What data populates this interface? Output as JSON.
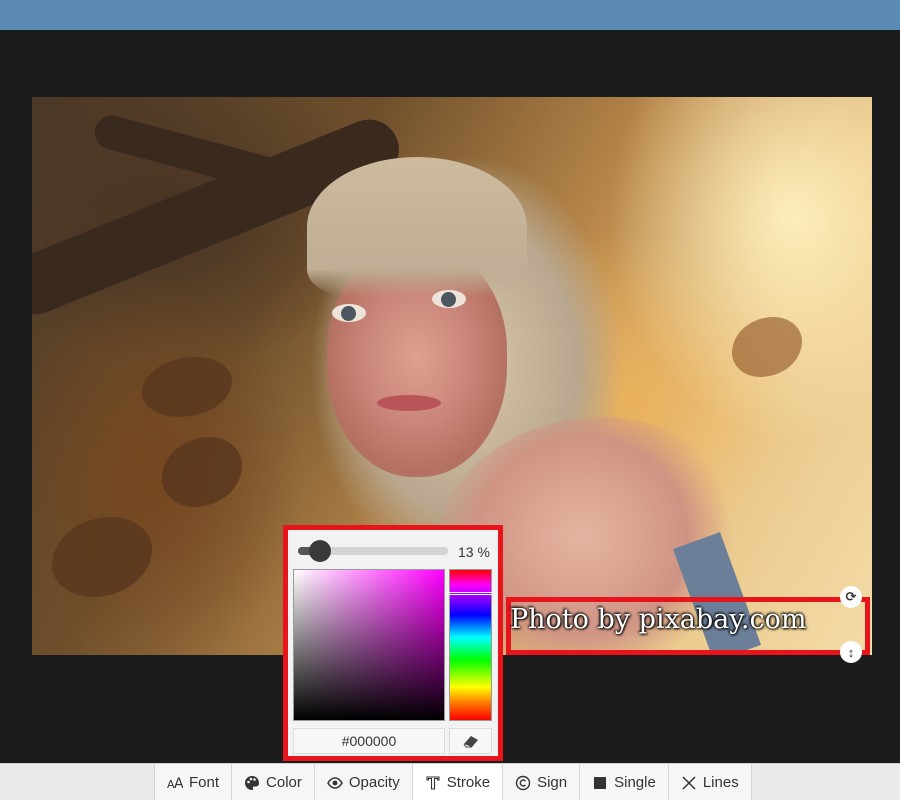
{
  "watermark": {
    "text": "Photo by pixabay.com"
  },
  "picker": {
    "opacity_percent": 13,
    "opacity_label": "13 %",
    "hex_value": "#000000",
    "hue_color": "#ff00ff"
  },
  "toolbar": {
    "items": [
      {
        "label": "Font",
        "icon": "font-size-icon"
      },
      {
        "label": "Color",
        "icon": "palette-icon"
      },
      {
        "label": "Opacity",
        "icon": "eye-icon"
      },
      {
        "label": "Stroke",
        "icon": "text-stroke-icon"
      },
      {
        "label": "Sign",
        "icon": "copyright-icon"
      },
      {
        "label": "Single",
        "icon": "square-icon"
      },
      {
        "label": "Lines",
        "icon": "x-lines-icon"
      }
    ]
  },
  "colors": {
    "accent": "#e8141c",
    "topbar": "#5b8bb4",
    "canvas": "#1c1c1c"
  }
}
